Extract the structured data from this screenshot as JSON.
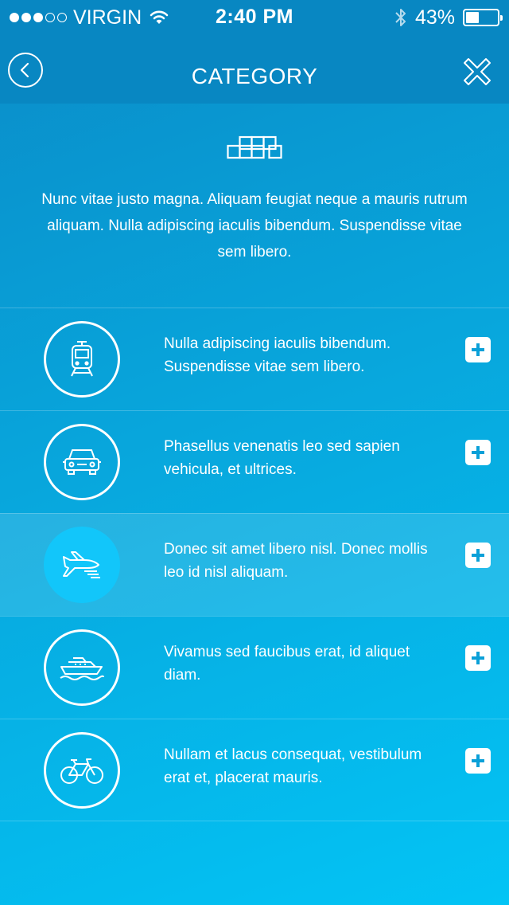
{
  "status_bar": {
    "carrier": "VIRGIN",
    "time": "2:40 PM",
    "battery": "43%",
    "battery_level": 0.43,
    "signal_bars_filled": 3,
    "signal_bars_total": 5
  },
  "nav": {
    "title": "CATEGORY",
    "back_icon": "chevron-left-circle-icon",
    "close_icon": "close-icon"
  },
  "hero": {
    "icon": "blocks-icon",
    "text": "Nunc vitae justo magna. Aliquam feugiat neque a mauris rutrum aliquam. Nulla adipiscing iaculis bibendum. Suspendisse vitae sem libero."
  },
  "items": [
    {
      "icon": "train-icon",
      "text": "Nulla adipiscing iaculis bibendum. Suspendisse vitae sem libero.",
      "active": false
    },
    {
      "icon": "car-icon",
      "text": "Phasellus venenatis leo sed sapien vehicula, et ultrices.",
      "active": false
    },
    {
      "icon": "airplane-icon",
      "text": "Donec sit amet libero nisl. Donec mollis leo id nisl aliquam.",
      "active": true
    },
    {
      "icon": "ship-icon",
      "text": "Vivamus sed faucibus erat, id aliquet diam.",
      "active": false
    },
    {
      "icon": "bicycle-icon",
      "text": "Nullam et lacus consequat, vestibulum erat et, placerat mauris.",
      "active": false
    }
  ],
  "colors": {
    "nav_bg": "#0887c2",
    "active_circle": "#12c6fa",
    "add_button_icon": "#0aa0d8"
  }
}
